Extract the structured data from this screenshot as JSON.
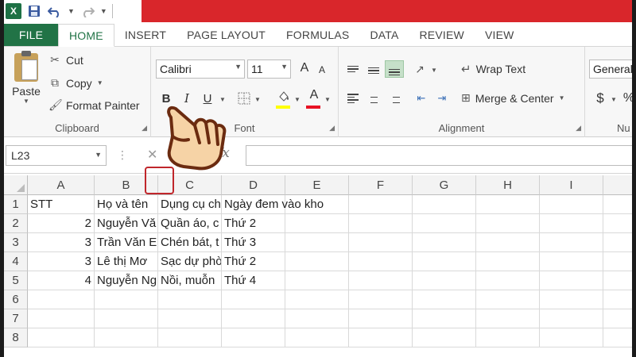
{
  "quick_access": {
    "app_icon": "excel-icon",
    "icons": [
      "save-icon",
      "undo-icon",
      "redo-icon"
    ]
  },
  "tabs": [
    "FILE",
    "HOME",
    "INSERT",
    "PAGE LAYOUT",
    "FORMULAS",
    "DATA",
    "REVIEW",
    "VIEW"
  ],
  "active_tab": "HOME",
  "clipboard": {
    "paste": "Paste",
    "cut": "Cut",
    "copy": "Copy",
    "format_painter": "Format Painter",
    "label": "Clipboard"
  },
  "font": {
    "family": "Calibri",
    "size": "11",
    "bold": "B",
    "italic": "I",
    "underline": "U",
    "label": "Font",
    "fill_color": "#ffff00",
    "font_color": "#e81123"
  },
  "alignment": {
    "wrap_text": "Wrap Text",
    "merge_center": "Merge & Center",
    "label": "Alignment"
  },
  "number": {
    "format": "General",
    "currency": "$",
    "percent": "%",
    "label": "Nu"
  },
  "formula_bar": {
    "name_box": "L23",
    "fx": "fx",
    "value": ""
  },
  "columns": [
    "A",
    "B",
    "",
    "C",
    "D",
    "E",
    "F",
    "G",
    "H",
    "I"
  ],
  "rows": [
    "1",
    "2",
    "3",
    "4",
    "5",
    "6",
    "7",
    "8"
  ],
  "cells": {
    "A1": "STT",
    "B1": "Họ và tên",
    "C1": "Dụng cụ ch",
    "D1": "Ngày đem vào kho",
    "A2": "2",
    "B2": "Nguyễn Vă",
    "C2": "Quần áo, c",
    "D2": "Thứ 2",
    "A3": "3",
    "B3": "Trần Văn E",
    "C3": "Chén bát, t",
    "D3": "Thứ 3",
    "A4": "3",
    "B4": "Lê thị Mơ",
    "C4": "Sạc dự phò",
    "D4": "Thứ 2",
    "A5": "4",
    "B5": "Nguyễn Ng",
    "C5": "Nồi, muỗn",
    "D5": "Thứ 4"
  },
  "colors": {
    "excel_green": "#217346",
    "title_red": "#d9262b",
    "highlight_red": "#c0262b"
  }
}
